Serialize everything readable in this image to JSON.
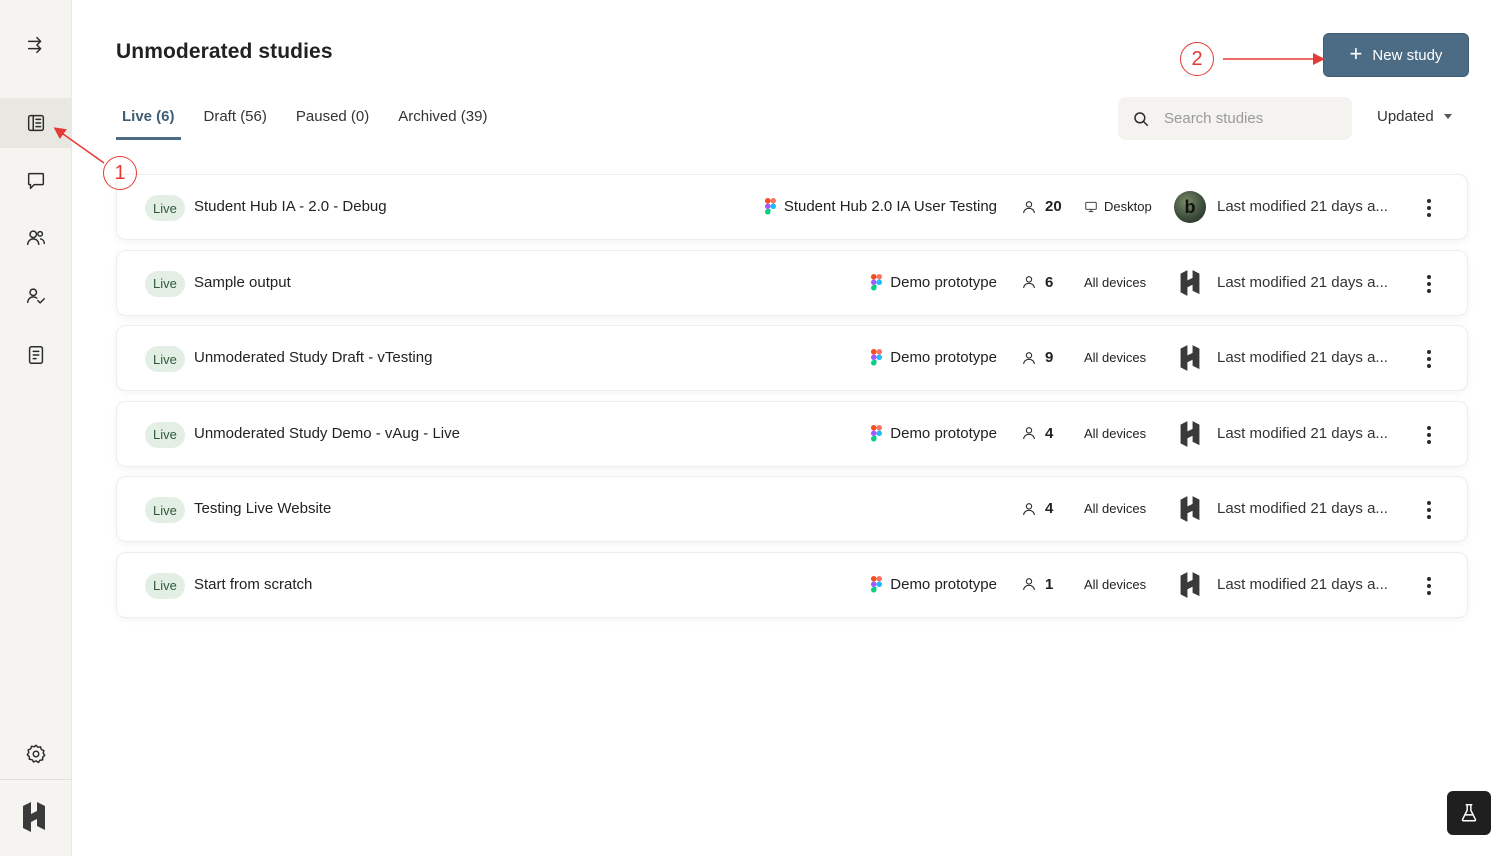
{
  "header": {
    "title": "Unmoderated studies",
    "new_study_label": "New study"
  },
  "tabs": [
    {
      "label": "Live (6)",
      "active": true
    },
    {
      "label": "Draft (56)",
      "active": false
    },
    {
      "label": "Paused (0)",
      "active": false
    },
    {
      "label": "Archived (39)",
      "active": false
    }
  ],
  "search": {
    "placeholder": "Search studies",
    "value": ""
  },
  "sort": {
    "label": "Updated"
  },
  "sidebar": {
    "items": [
      {
        "name": "collapse-sidebar",
        "icon": "arrows-right-icon"
      },
      {
        "name": "studies",
        "icon": "book-icon",
        "active": true
      },
      {
        "name": "messages",
        "icon": "chat-icon"
      },
      {
        "name": "participants",
        "icon": "users-icon"
      },
      {
        "name": "panel",
        "icon": "user-check-icon"
      },
      {
        "name": "reports",
        "icon": "document-icon"
      },
      {
        "name": "settings",
        "icon": "gear-icon"
      }
    ]
  },
  "studies": [
    {
      "status": "Live",
      "name": "Student Hub IA - 2.0 - Debug",
      "prototype": "Student Hub 2.0 IA User Testing",
      "participants": "20",
      "device": "Desktop",
      "owner": "photo",
      "modified": "Last modified 21 days a..."
    },
    {
      "status": "Live",
      "name": "Sample output",
      "prototype": "Demo prototype",
      "participants": "6",
      "device": "All devices",
      "owner": "logo",
      "modified": "Last modified 21 days a..."
    },
    {
      "status": "Live",
      "name": "Unmoderated Study Draft - vTesting",
      "prototype": "Demo prototype",
      "participants": "9",
      "device": "All devices",
      "owner": "logo",
      "modified": "Last modified 21 days a..."
    },
    {
      "status": "Live",
      "name": "Unmoderated Study Demo - vAug - Live",
      "prototype": "Demo prototype",
      "participants": "4",
      "device": "All devices",
      "owner": "logo",
      "modified": "Last modified 21 days a..."
    },
    {
      "status": "Live",
      "name": "Testing Live Website",
      "prototype": "",
      "participants": "4",
      "device": "All devices",
      "owner": "logo",
      "modified": "Last modified 21 days a..."
    },
    {
      "status": "Live",
      "name": "Start from scratch",
      "prototype": "Demo prototype",
      "participants": "1",
      "device": "All devices",
      "owner": "logo",
      "modified": "Last modified 21 days a..."
    }
  ],
  "annotations": [
    {
      "label": "1"
    },
    {
      "label": "2"
    }
  ],
  "colors": {
    "accent": "#4c6c86",
    "annotation": "#e53935",
    "live_badge_bg": "#e3efe5"
  }
}
